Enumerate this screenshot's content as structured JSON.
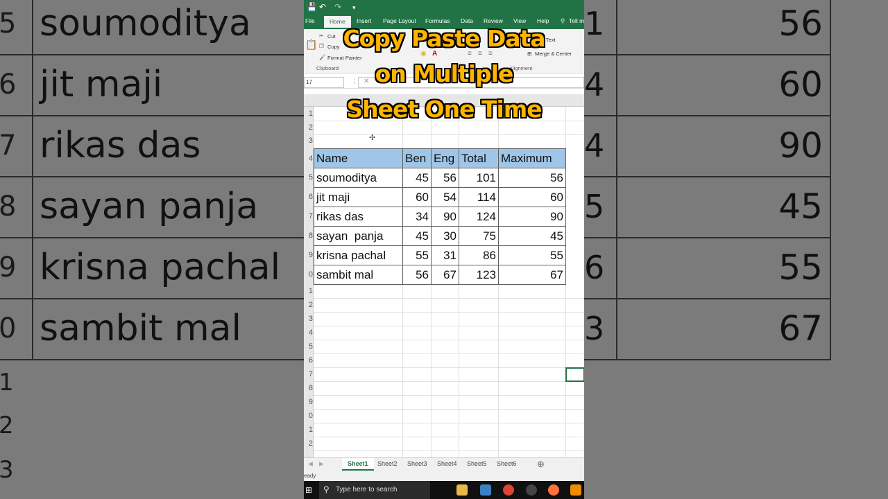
{
  "overlay": {
    "line1": "Copy Paste Data",
    "line2": "on Multiple",
    "line3": "Sheet One Time"
  },
  "ribbon": {
    "tabs": [
      "File",
      "Home",
      "Insert",
      "Page Layout",
      "Formulas",
      "Data",
      "Review",
      "View",
      "Help",
      "Tell m"
    ],
    "active_tab": "Home",
    "cut": "Cut",
    "copy": "Copy",
    "format_painter": "Format Painter",
    "clipboard_group": "Clipboard",
    "wrap_text": "rap Text",
    "merge_center": "Merge & Center",
    "alignment_group": "Alignment"
  },
  "name_box": "17",
  "table": {
    "headers": [
      "Name",
      "Ben",
      "Eng",
      "Total",
      "Maximum"
    ],
    "rows": [
      [
        "soumoditya",
        "45",
        "56",
        "101",
        "56"
      ],
      [
        "jit maji",
        "60",
        "54",
        "114",
        "60"
      ],
      [
        "rikas das",
        "34",
        "90",
        "124",
        "90"
      ],
      [
        "sayan  panja",
        "45",
        "30",
        "75",
        "45"
      ],
      [
        "krisna pachal",
        "55",
        "31",
        "86",
        "55"
      ],
      [
        "sambit mal",
        "56",
        "67",
        "123",
        "67"
      ]
    ]
  },
  "row_numbers": [
    "1",
    "2",
    "3",
    "4",
    "5",
    "6",
    "7",
    "8",
    "9",
    "0",
    "1",
    "2",
    "3",
    "4",
    "5",
    "6",
    "7",
    "8",
    "9",
    "0",
    "1",
    "2"
  ],
  "sheet_tabs": [
    "Sheet1",
    "Sheet2",
    "Sheet3",
    "Sheet4",
    "Sheet5",
    "Sheet6"
  ],
  "status": "eady",
  "taskbar": {
    "search_placeholder": "Type here to search"
  },
  "side_left": {
    "rows": [
      {
        "num": "5",
        "name": "soumoditya"
      },
      {
        "num": "6",
        "name": "jit maji"
      },
      {
        "num": "7",
        "name": "rikas das"
      },
      {
        "num": "8",
        "name": "sayan  panja"
      },
      {
        "num": "9",
        "name": "krisna pachal"
      },
      {
        "num": "0",
        "name": "sambit mal"
      },
      {
        "num": "1",
        "name": ""
      },
      {
        "num": "2",
        "name": ""
      },
      {
        "num": "3",
        "name": ""
      }
    ]
  },
  "side_right": {
    "rows": [
      {
        "lead": "1",
        "max": "56"
      },
      {
        "lead": "4",
        "max": "60"
      },
      {
        "lead": "4",
        "max": "90"
      },
      {
        "lead": "5",
        "max": "45"
      },
      {
        "lead": "6",
        "max": "55"
      },
      {
        "lead": "3",
        "max": "67"
      }
    ]
  }
}
